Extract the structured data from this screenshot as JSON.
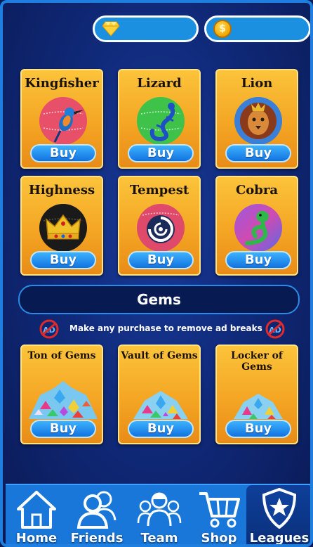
{
  "currency": {
    "gems_icon": "diamond-icon",
    "coins_icon": "coin-icon",
    "coin_glyph": "$"
  },
  "balls": [
    {
      "name": "Kingfisher",
      "buy": "Buy"
    },
    {
      "name": "Lizard",
      "buy": "Buy"
    },
    {
      "name": "Lion",
      "buy": "Buy"
    },
    {
      "name": "Highness",
      "buy": "Buy"
    },
    {
      "name": "Tempest",
      "buy": "Buy"
    },
    {
      "name": "Cobra",
      "buy": "Buy"
    }
  ],
  "gems_section": {
    "title": "Gems",
    "notice": "Make any purchase to remove ad breaks",
    "items": [
      {
        "name": "Ton of Gems",
        "buy": "Buy"
      },
      {
        "name": "Vault of Gems",
        "buy": "Buy"
      },
      {
        "name": "Locker of Gems",
        "buy": "Buy"
      }
    ]
  },
  "nav": {
    "items": [
      {
        "label": "Home",
        "icon": "home-icon"
      },
      {
        "label": "Friends",
        "icon": "friends-icon"
      },
      {
        "label": "Team",
        "icon": "team-icon"
      },
      {
        "label": "Shop",
        "icon": "cart-icon"
      },
      {
        "label": "Leagues",
        "icon": "leagues-shield-icon"
      }
    ],
    "active": "Leagues"
  },
  "colors": {
    "background": "#102a7a",
    "card": "#f3a322",
    "button": "#1b8fe0",
    "nav": "#1877d8"
  }
}
